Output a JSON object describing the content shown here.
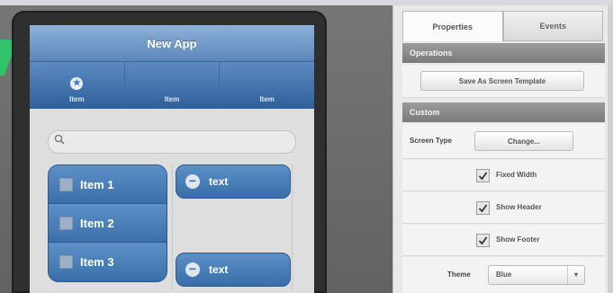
{
  "app": {
    "title": "New App",
    "tabs": [
      {
        "label": "Item",
        "icon": "star-icon"
      },
      {
        "label": "Item"
      },
      {
        "label": "Item"
      }
    ],
    "search": {
      "placeholder": ""
    },
    "list_items": [
      {
        "label": "Item 1"
      },
      {
        "label": "Item 2"
      },
      {
        "label": "Item 3"
      }
    ],
    "buttons": [
      {
        "label": "text"
      },
      {
        "label": "text"
      }
    ]
  },
  "panel": {
    "tabs": [
      {
        "label": "Properties",
        "active": true
      },
      {
        "label": "Events",
        "active": false
      }
    ],
    "sections": {
      "operations": "Operations",
      "custom": "Custom"
    },
    "save_template_button": "Save As Screen Template",
    "screen_type": {
      "label": "Screen Type",
      "button": "Change..."
    },
    "checkboxes": [
      {
        "label": "Fixed Width",
        "checked": true
      },
      {
        "label": "Show Header",
        "checked": true
      },
      {
        "label": "Show Footer",
        "checked": true
      }
    ],
    "theme": {
      "label": "Theme",
      "value": "Blue"
    }
  },
  "colors": {
    "app_blue": "#3a6ea8",
    "panel_bg": "#e9e9e9",
    "section_gray": "#8a8a8a",
    "accent_green": "#2fc46a"
  }
}
